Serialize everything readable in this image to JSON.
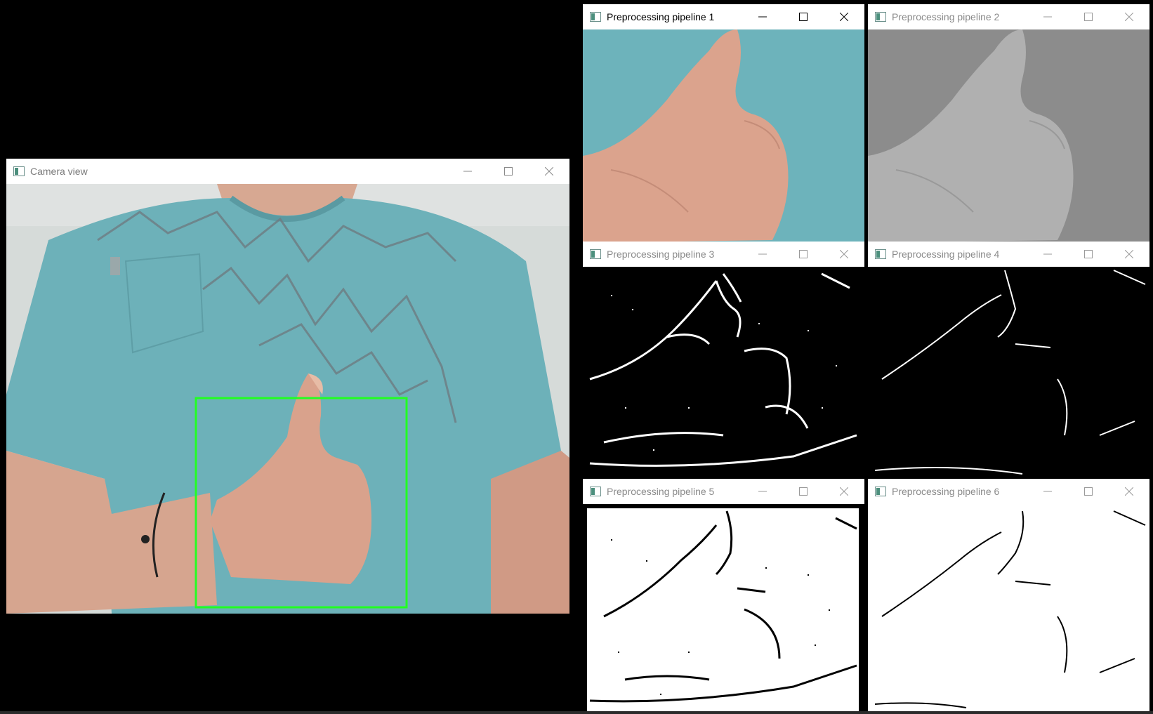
{
  "windows": {
    "camera": {
      "title": "Camera view",
      "roi_color": "#22ff22"
    },
    "p1": {
      "title": "Preprocessing pipeline 1"
    },
    "p2": {
      "title": "Preprocessing pipeline 2"
    },
    "p3": {
      "title": "Preprocessing pipeline 3"
    },
    "p4": {
      "title": "Preprocessing pipeline 4"
    },
    "p5": {
      "title": "Preprocessing pipeline 5"
    },
    "p6": {
      "title": "Preprocessing pipeline 6"
    }
  },
  "icons": {
    "app": "opencv-window-icon",
    "minimize": "minimize-icon",
    "maximize": "maximize-icon",
    "close": "close-icon"
  },
  "colors": {
    "shirt": "#6fb3ba",
    "skin": "#d9a48e",
    "wall": "#d8dcda",
    "gray_bg": "#8e8e8e",
    "gray_hand": "#b3b3b3"
  }
}
